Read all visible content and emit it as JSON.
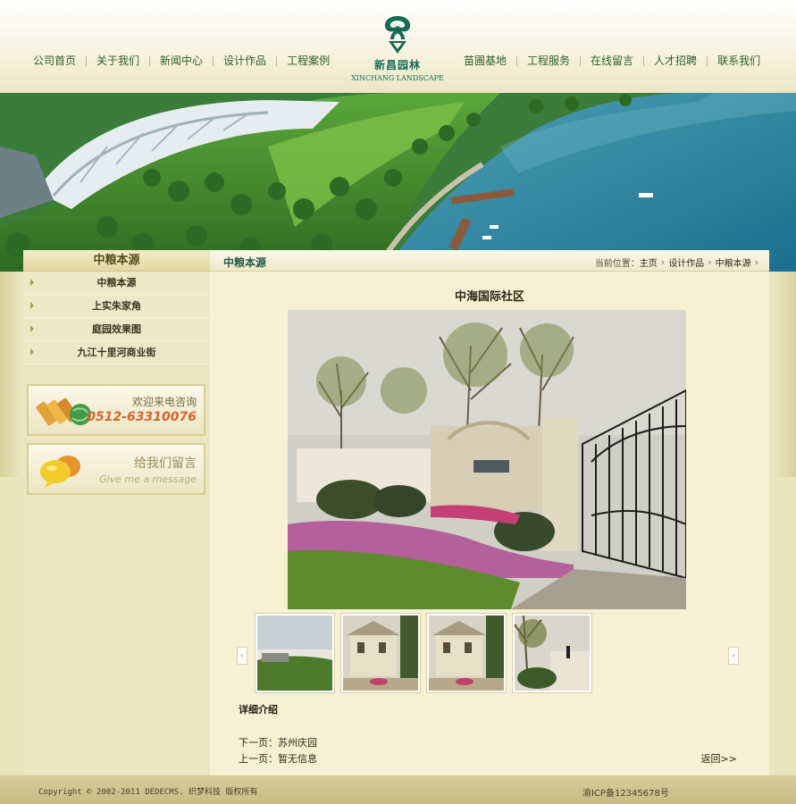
{
  "nav": {
    "left": [
      "公司首页",
      "关于我们",
      "新闻中心",
      "设计作品",
      "工程案例"
    ],
    "right": [
      "苗圃基地",
      "工程服务",
      "在线留言",
      "人才招聘",
      "联系我们"
    ]
  },
  "logo": {
    "cn": "新昌园林",
    "en": "XINCHANG LANDSCAPE",
    "icon": "tree-logo-icon"
  },
  "sidebar": {
    "title": "中粮本源",
    "items": [
      "中粮本源",
      "上实朱家角",
      "庭园效果图",
      "九江十里河商业街"
    ],
    "phone_promo": {
      "line1": "欢迎来电咨询",
      "line2": "0512-63310076",
      "icon": "gold-phone-icon"
    },
    "message_promo": {
      "line1": "给我们留言",
      "line2": "Give me a message",
      "icon": "chat-bubbles-icon"
    }
  },
  "content": {
    "section_title": "中粮本源",
    "breadcrumb": {
      "prefix": "当前位置：",
      "items": [
        "主页",
        "设计作品",
        "中粮本源"
      ]
    },
    "article_title": "中海国际社区",
    "detail_label": "详细介绍",
    "next_page": "下一页：苏州庆园",
    "prev_page": "上一页：暂无信息",
    "back": "返回>>",
    "thumb_prev": "‹",
    "thumb_next": "›"
  },
  "footer": {
    "copyright": "Copyright © 2002-2011 DEDECMS. 织梦科技 版权所有",
    "icp": "渝ICP备12345678号"
  },
  "colors": {
    "nav_text": "#2f5f2c",
    "logo_green": "#146b54",
    "page_bg": "#ebe5bd",
    "content_bg": "#f6f1d3",
    "phone_orange": "#d8662b"
  }
}
